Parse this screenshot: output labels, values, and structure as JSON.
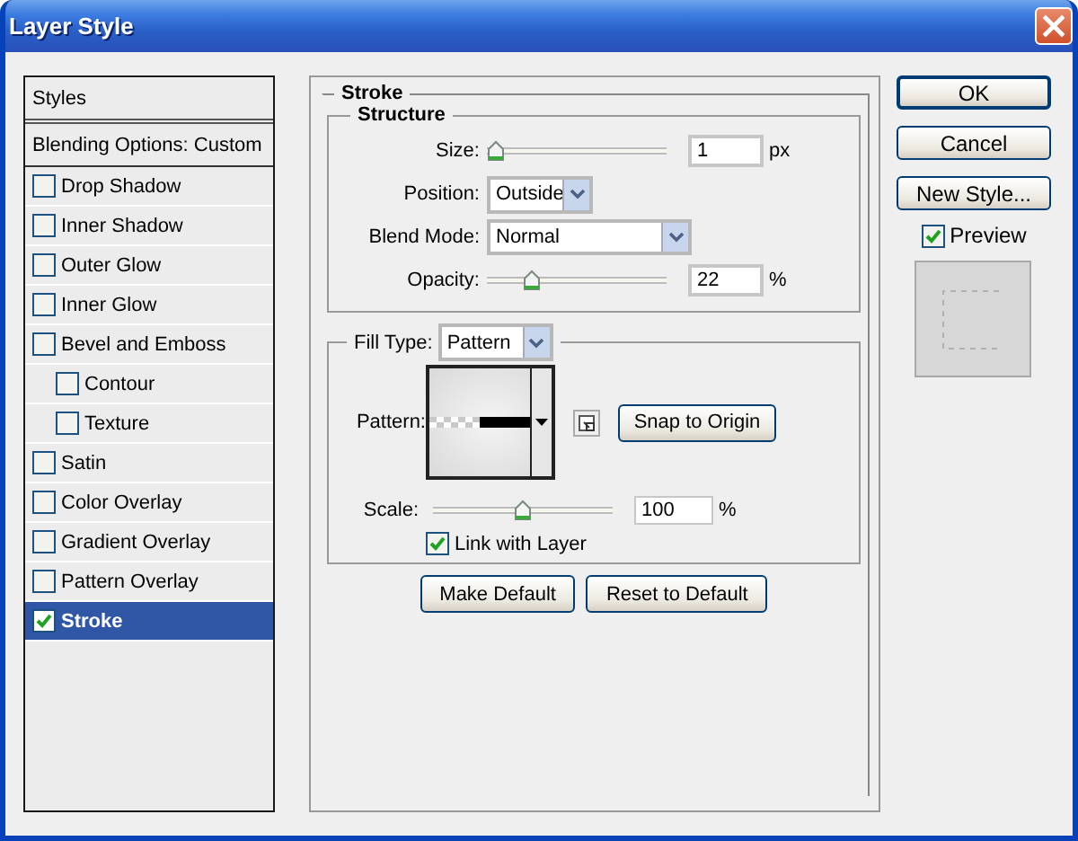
{
  "window": {
    "title": "Layer Style"
  },
  "sidebar": {
    "items": [
      {
        "kind": "heading",
        "label": "Styles",
        "selected": false
      },
      {
        "kind": "heading",
        "label": "Blending Options: Custom",
        "selected": false
      },
      {
        "kind": "check",
        "label": "Drop Shadow",
        "checked": false,
        "selected": false
      },
      {
        "kind": "check",
        "label": "Inner Shadow",
        "checked": false,
        "selected": false
      },
      {
        "kind": "check",
        "label": "Outer Glow",
        "checked": false,
        "selected": false
      },
      {
        "kind": "check",
        "label": "Inner Glow",
        "checked": false,
        "selected": false
      },
      {
        "kind": "check",
        "label": "Bevel and Emboss",
        "checked": false,
        "selected": false,
        "children": [
          {
            "kind": "check",
            "label": "Contour",
            "checked": false,
            "selected": false
          },
          {
            "kind": "check",
            "label": "Texture",
            "checked": false,
            "selected": false
          }
        ]
      },
      {
        "kind": "check",
        "label": "Satin",
        "checked": false,
        "selected": false
      },
      {
        "kind": "check",
        "label": "Color Overlay",
        "checked": false,
        "selected": false
      },
      {
        "kind": "check",
        "label": "Gradient Overlay",
        "checked": false,
        "selected": false
      },
      {
        "kind": "check",
        "label": "Pattern Overlay",
        "checked": false,
        "selected": false
      },
      {
        "kind": "check",
        "label": "Stroke",
        "checked": true,
        "selected": true
      }
    ]
  },
  "stroke": {
    "title": "Stroke",
    "structure": {
      "title": "Structure",
      "size": {
        "label": "Size:",
        "level": 0,
        "value": "1",
        "unit": "px"
      },
      "position": {
        "label": "Position:",
        "value": "Outside"
      },
      "blend_mode": {
        "label": "Blend Mode:",
        "value": "Normal"
      },
      "opacity": {
        "label": "Opacity:",
        "level": 0.22,
        "value": "22",
        "unit": "%"
      }
    },
    "fill": {
      "label": "Fill Type:",
      "value": "Pattern",
      "pattern_label": "Pattern:",
      "snap_button": "Snap to Origin",
      "scale": {
        "label": "Scale:",
        "level": 0.5,
        "value": "100",
        "unit": "%"
      },
      "link_with_layer": {
        "label": "Link with Layer",
        "checked": true
      }
    },
    "buttons": [
      "Make Default",
      "Reset to Default"
    ]
  },
  "actions": {
    "buttons": [
      "OK",
      "Cancel",
      "New Style..."
    ],
    "preview": {
      "label": "Preview",
      "checked": true
    }
  }
}
